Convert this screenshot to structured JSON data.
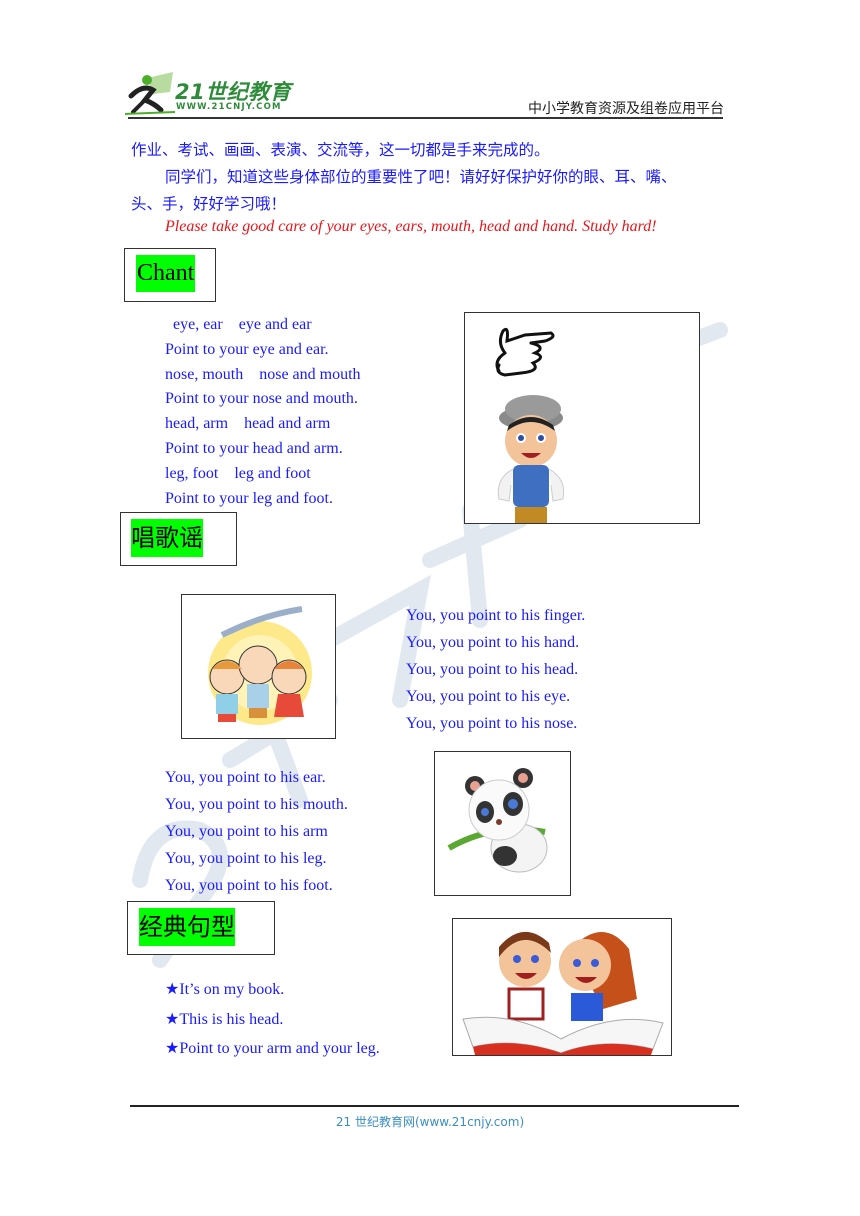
{
  "header": {
    "logo_text": "21世纪教育",
    "logo_url": "WWW.21CNJY.COM",
    "tagline": "中小学教育资源及组卷应用平台"
  },
  "intro": {
    "line1": "作业、考试、画画、表演、交流等，这一切都是手来完成的。",
    "line2": "同学们，知道这些身体部位的重要性了吧！请好好保护好你的眼、耳、嘴、",
    "line3": "头、手，好好学习哦！",
    "english": "Please take good care of your eyes, ears, mouth, head and hand. Study hard!",
    "english_color": "#e8151a"
  },
  "sections": {
    "chant": {
      "title": "Chant",
      "lines": [
        "  eye, ear    eye and ear",
        "Point to your eye and ear.",
        "nose, mouth    nose and mouth",
        "Point to your nose and mouth.",
        "head, arm    head and arm",
        "Point to your head and arm.",
        "leg, foot    leg and foot",
        "Point to your leg and foot."
      ],
      "image": "pointing-hand-and-boy-illustration"
    },
    "song": {
      "title": "唱歌谣",
      "lines_a": [
        "You, you point to his finger.",
        "You, you point to his hand.",
        "You, you point to his head.",
        "You, you point to his eye.",
        "You, you point to his nose."
      ],
      "lines_b": [
        "You, you point to his ear.",
        "You, you point to his mouth.",
        "You, you point to his arm",
        "You, you point to his leg.",
        "You, you point to his foot."
      ],
      "image_a": "singing-children-illustration",
      "image_b": "panda-with-bamboo-illustration"
    },
    "pattern": {
      "title": "经典句型",
      "lines": [
        "★It’s on my book.",
        "★This is his head.",
        "★Point to your arm and your leg."
      ],
      "image": "kids-reading-book-illustration"
    }
  },
  "footer": {
    "text": "21 世纪教育网(www.21cnjy.com)"
  },
  "colors": {
    "text_blue": "#1a1aff",
    "highlight_green": "#00ff00",
    "brand_green": "#2e8b3a",
    "footer_blue": "#3a8fc0"
  }
}
